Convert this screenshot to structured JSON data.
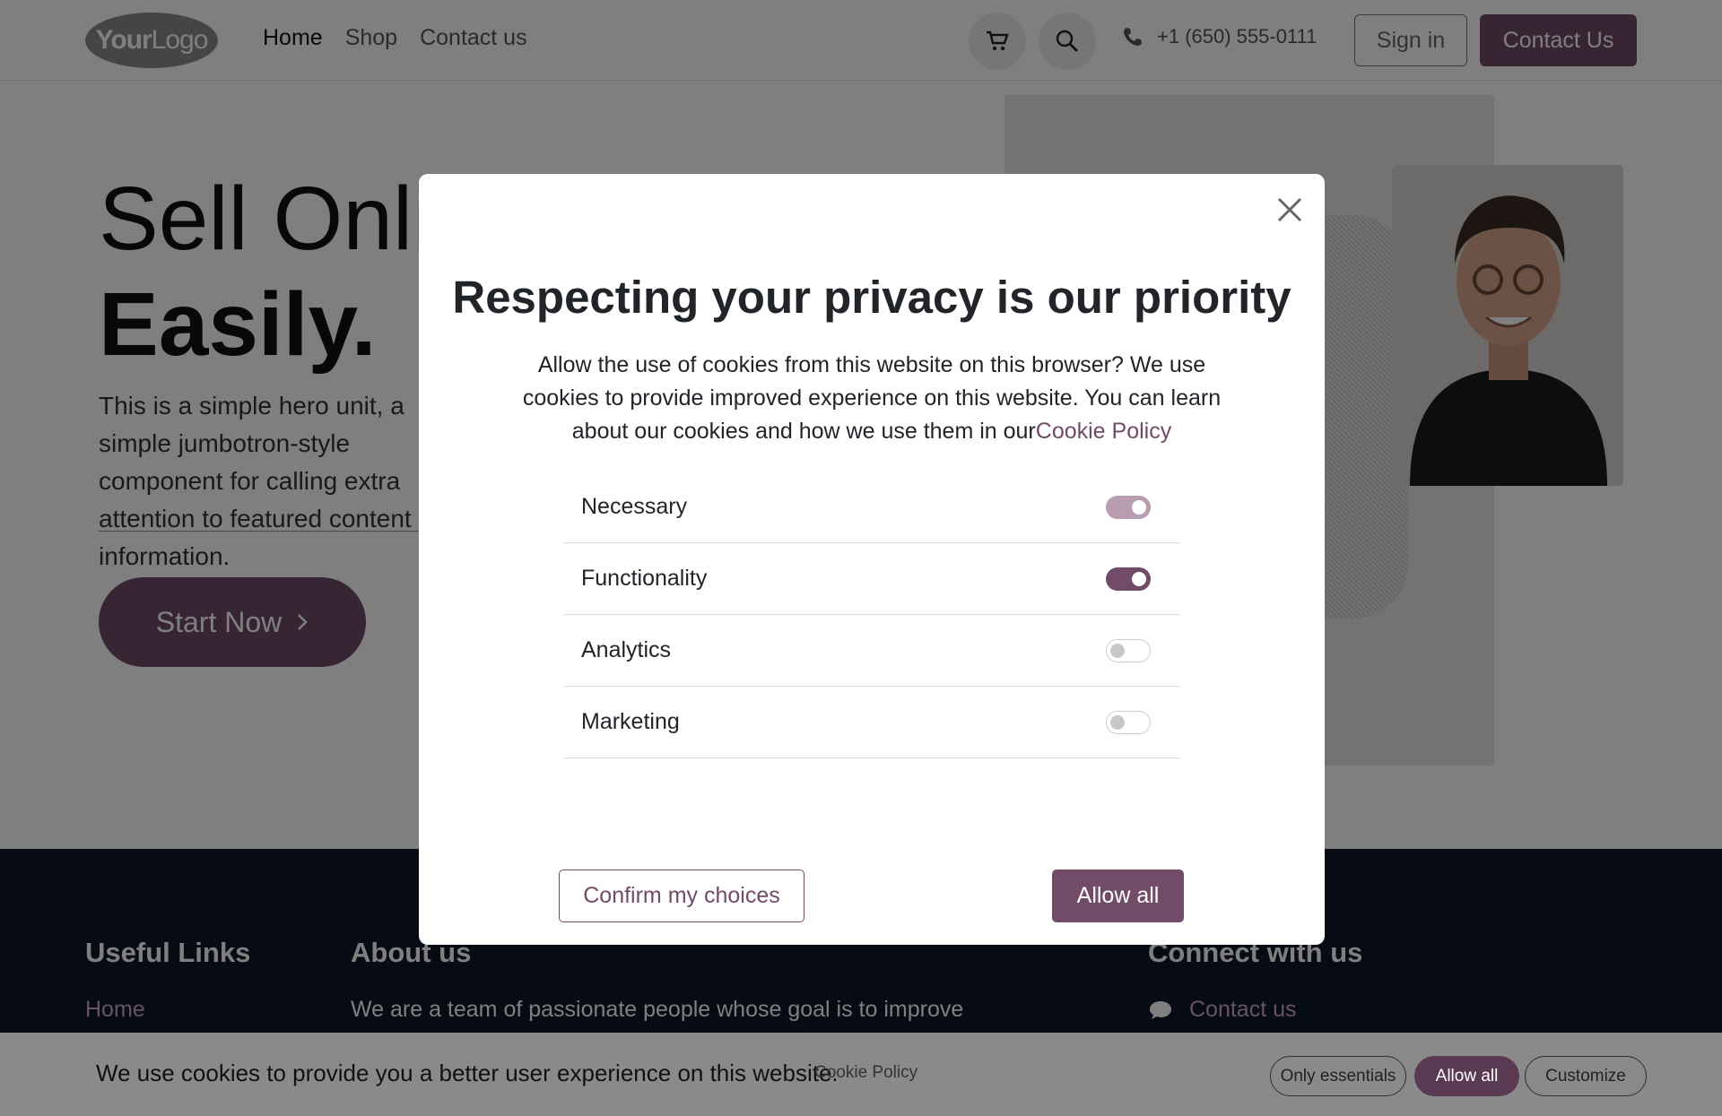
{
  "header": {
    "logo": {
      "bold": "Your",
      "light": "Logo"
    },
    "nav": [
      "Home",
      "Shop",
      "Contact us"
    ],
    "phone": "+1 (650) 555-0111",
    "sign_in": "Sign in",
    "contact_us": "Contact Us"
  },
  "hero": {
    "title_line1": "Sell Online",
    "title_line2": "Easily.",
    "text": "This is a simple hero unit, a simple jumbotron-style component for calling extra attention to featured content or information.",
    "cta": "Start Now"
  },
  "footer": {
    "useful_links_title": "Useful Links",
    "useful_links_first": "Home",
    "about_title": "About us",
    "about_text": "We are a team of passionate people whose goal is to improve",
    "connect_title": "Connect with us",
    "connect_first": "Contact us"
  },
  "cookie_bar": {
    "text": "We use cookies to provide you a better user experience on this website.",
    "link": "Cookie Policy",
    "only_essentials": "Only essentials",
    "allow_all": "Allow all",
    "customize": "Customize"
  },
  "modal": {
    "title": "Respecting your privacy is our priority",
    "description": "Allow the use of cookies from this website on this browser? We use cookies to provide improved experience on this website. You can learn about our cookies and how we use them in our",
    "policy_link": "Cookie Policy",
    "options": [
      {
        "label": "Necessary",
        "state": "on-disabled"
      },
      {
        "label": "Functionality",
        "state": "on"
      },
      {
        "label": "Analytics",
        "state": "off"
      },
      {
        "label": "Marketing",
        "state": "off"
      }
    ],
    "confirm": "Confirm my choices",
    "allow_all": "Allow all"
  },
  "colors": {
    "brand": "#714b67",
    "footer_bg": "#0f1629"
  }
}
